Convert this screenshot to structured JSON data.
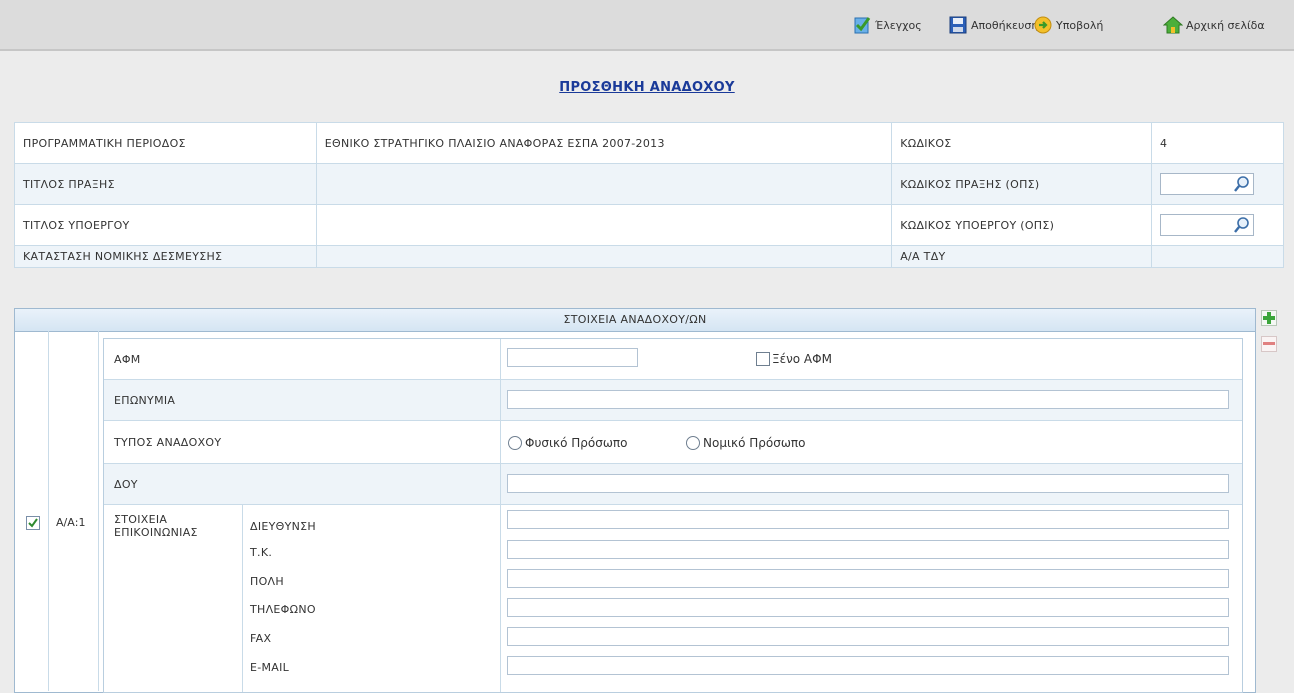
{
  "toolbar": {
    "check_label": "Έλεγχος",
    "save_label": "Αποθήκευση",
    "submit_label": "Υποβολή",
    "home_label": "Αρχική σελίδα"
  },
  "page_title": "ΠΡΟΣΘΗΚΗ ΑΝΑΔΟΧΟΥ",
  "info": {
    "period_label": "ΠΡΟΓΡΑΜΜΑΤΙΚΗ ΠΕΡΙΟΔΟΣ",
    "period_value": "ΕΘΝΙΚΟ ΣΤΡΑΤΗΓΙΚΟ ΠΛΑΙΣΙΟ ΑΝΑΦΟΡΑΣ ΕΣΠΑ 2007-2013",
    "code_label": "ΚΩΔΙΚΟΣ",
    "code_value": "4",
    "project_title_label": "ΤΙΤΛΟΣ ΠΡΑΞΗΣ",
    "project_title_value": "",
    "project_code_label": "ΚΩΔΙΚΟΣ ΠΡΑΞΗΣ (ΟΠΣ)",
    "project_code_value": "",
    "subproject_title_label": "ΤΙΤΛΟΣ ΥΠΟΕΡΓΟΥ",
    "subproject_title_value": "",
    "subproject_code_label": "ΚΩΔΙΚΟΣ ΥΠΟΕΡΓΟΥ (ΟΠΣ)",
    "subproject_code_value": "",
    "legal_status_label": "ΚΑΤΑΣΤΑΣΗ ΝΟΜΙΚΗΣ ΔΕΣΜΕΥΣΗΣ",
    "legal_status_value": "",
    "aa_tdy_label": "Α/Α ΤΔΥ",
    "aa_tdy_value": ""
  },
  "contractor": {
    "header": "ΣΤΟΙΧΕΙΑ ΑΝΑΔΟΧΟΥ/ΩΝ",
    "row_label": "Α/Α:1",
    "row_checked": true,
    "afm_label": "ΑΦΜ",
    "afm_value": "",
    "foreign_afm_label": "Ξένο ΑΦΜ",
    "foreign_afm_checked": false,
    "name_label": "ΕΠΩΝΥΜΙΑ",
    "name_value": "",
    "type_label": "ΤΥΠΟΣ ΑΝΑΔΟΧΟΥ",
    "type_options": [
      "Φυσικό Πρόσωπο",
      "Νομικό Πρόσωπο"
    ],
    "type_selected": "",
    "doy_label": "ΔΟΥ",
    "doy_value": "",
    "contact_label_1": "ΣΤΟΙΧΕΙΑ",
    "contact_label_2": "ΕΠΙΚΟΙΝΩΝΙΑΣ",
    "address_label": "ΔΙΕΥΘΥΝΣΗ",
    "postal_label": "Τ.Κ.",
    "city_label": "ΠΟΛΗ",
    "phone_label": "ΤΗΛΕΦΩΝΟ",
    "fax_label": "FAX",
    "email_label": "E-MAIL",
    "address_value": "",
    "postal_value": "",
    "city_value": "",
    "phone_value": "",
    "fax_value": "",
    "email_value": ""
  },
  "colors": {
    "title": "#1a3a99",
    "border": "#9fb9d0",
    "alt_row": "#eef4f9",
    "add": "#3aa53a",
    "remove": "#e08080"
  }
}
